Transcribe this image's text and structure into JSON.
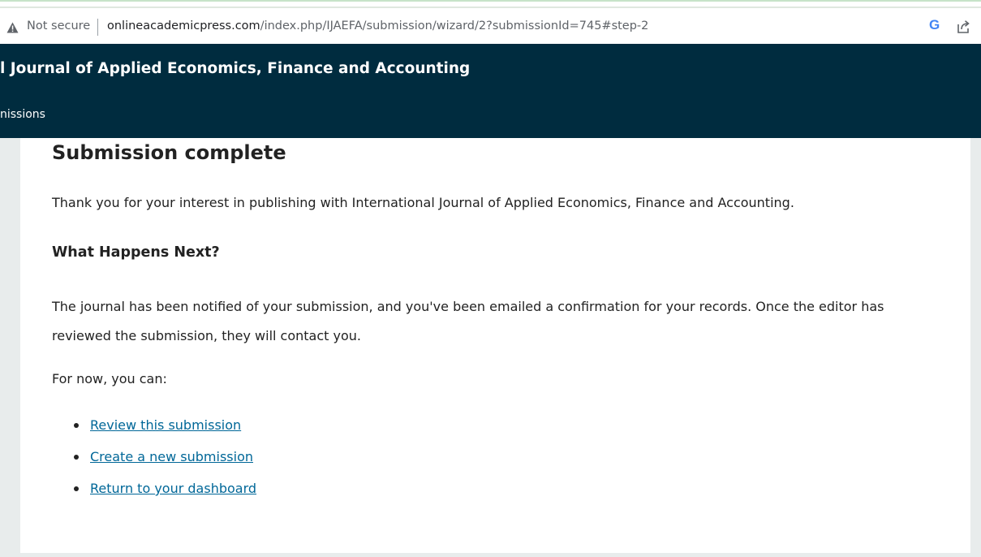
{
  "browser": {
    "security_label": "Not secure",
    "url_host": "onlineacademicpress.com",
    "url_path": "/index.php/IJAEFA/submission/wizard/2?submissionId=745#step-2",
    "google_letter": "G",
    "icons": [
      "warning-triangle-icon",
      "google-icon",
      "share-icon"
    ]
  },
  "header": {
    "title": "l Journal of Applied Economics, Finance and Accounting",
    "nav_label": "nissions",
    "background": "#002c3f"
  },
  "content": {
    "title": "Submission complete",
    "thanks": "Thank you for your interest in publishing with International Journal of Applied Economics, Finance and Accounting.",
    "next_heading": "What Happens Next?",
    "notified": "The journal has been notified of your submission, and you've been emailed a confirmation for your records. Once the editor has reviewed the submission, they will contact you.",
    "for_now": "For now, you can:",
    "actions": [
      {
        "label": "Review this submission"
      },
      {
        "label": "Create a new submission"
      },
      {
        "label": "Return to your dashboard"
      }
    ],
    "link_color": "#006798"
  }
}
